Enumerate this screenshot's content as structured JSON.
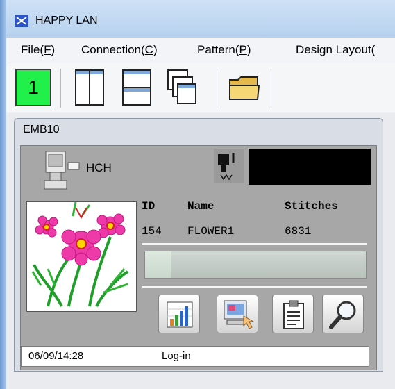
{
  "app": {
    "title": "HAPPY LAN"
  },
  "menu": [
    {
      "label": "File(",
      "acc": "F",
      "tail": ")"
    },
    {
      "label": "Connection(",
      "acc": "C",
      "tail": ")"
    },
    {
      "label": "Pattern(",
      "acc": "P",
      "tail": ")"
    },
    {
      "label": "Design Layout(",
      "acc": "",
      "tail": ""
    }
  ],
  "toolbar": {
    "machine_number": "1"
  },
  "panel": {
    "title": "EMB10",
    "machine_type": "HCH",
    "columns": {
      "id": "ID",
      "name": "Name",
      "stitches": "Stitches"
    },
    "row": {
      "id": "154",
      "name": "FLOWER1",
      "stitches": "6831"
    },
    "progress": 0.12,
    "status_date": "06/09/14:28",
    "status_state": "Log-in"
  },
  "colors": {
    "machine_active": "#22f04a"
  }
}
